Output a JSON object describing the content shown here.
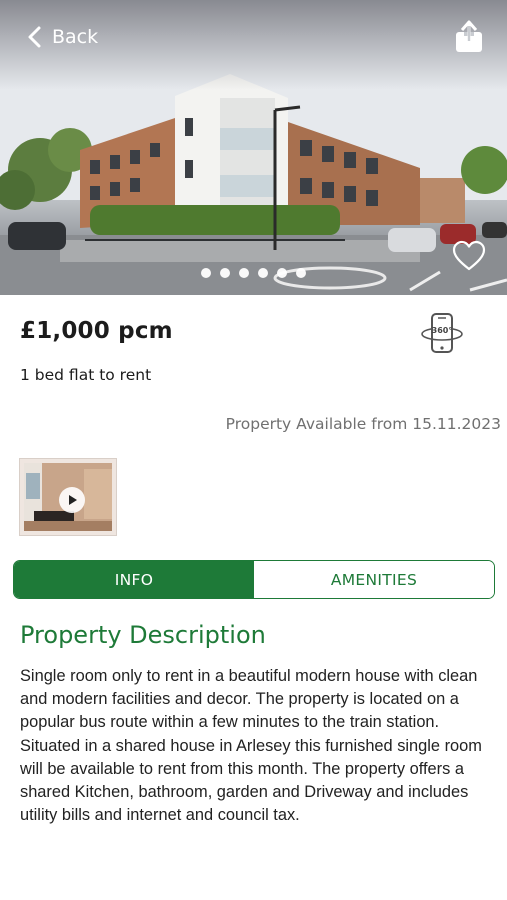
{
  "header": {
    "back_label": "Back",
    "back_icon": "chevron-left-icon",
    "share_icon": "share-icon"
  },
  "gallery": {
    "image_count": 6,
    "active_index": 0,
    "favorite_icon": "heart-outline-icon"
  },
  "listing": {
    "price": "£1,000 pcm",
    "subtitle": "1 bed flat to rent",
    "vr_icon": "360-view-phone-icon",
    "availability": "Property Available from 15.11.2023",
    "video_icon": "play-icon"
  },
  "tabs": [
    {
      "label": "INFO",
      "active": true
    },
    {
      "label": "AMENITIES",
      "active": false
    }
  ],
  "section": {
    "title": "Property Description",
    "description": "Single room only to rent in a beautiful modern house with clean and modern facilities and decor. The property is located on a popular bus route within a few minutes to the train station. Situated in a shared house in Arlesey this furnished single room will be available to rent from this month. The property offers a shared Kitchen, bathroom, garden and Driveway and includes utility bills and internet and council tax."
  },
  "colors": {
    "accent": "#1e7a38",
    "muted_text": "#707070"
  }
}
